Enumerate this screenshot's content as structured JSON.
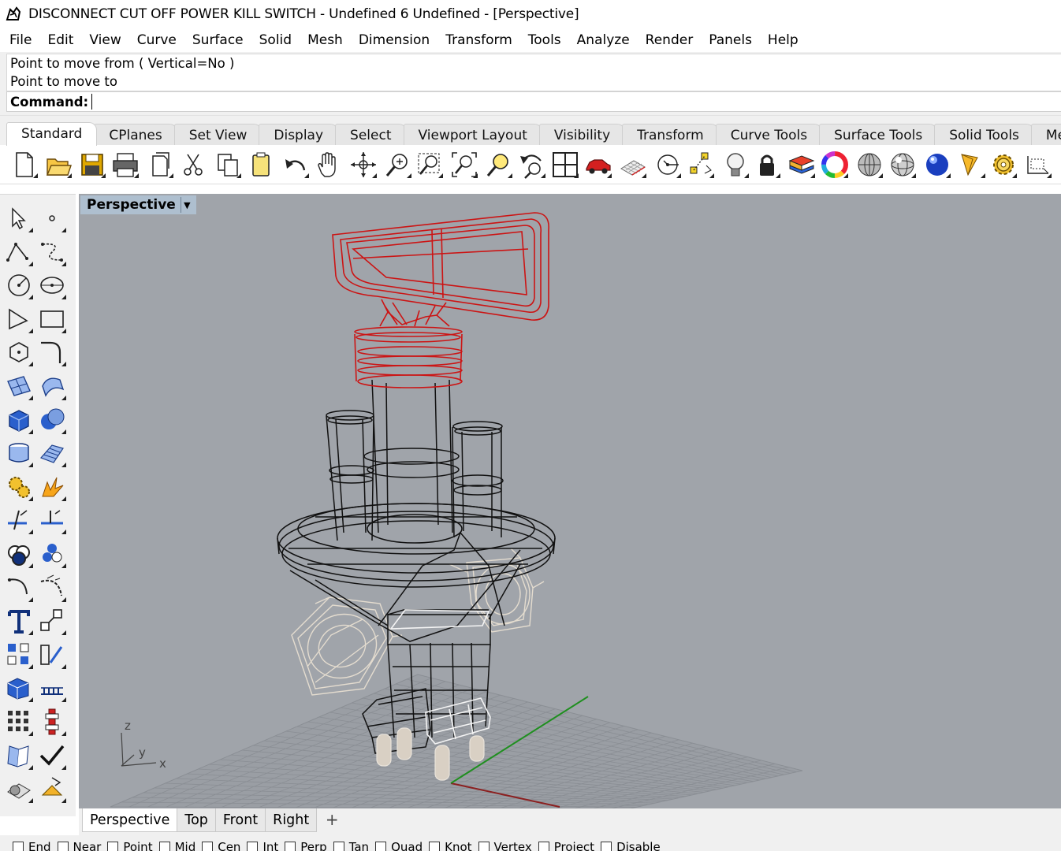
{
  "window": {
    "title": "DISCONNECT CUT OFF POWER KILL SWITCH - Undefined 6 Undefined - [Perspective]",
    "app_icon": "rhino-icon"
  },
  "menu": [
    "File",
    "Edit",
    "View",
    "Curve",
    "Surface",
    "Solid",
    "Mesh",
    "Dimension",
    "Transform",
    "Tools",
    "Analyze",
    "Render",
    "Panels",
    "Help"
  ],
  "command": {
    "history": [
      "Point to move from ( Vertical=No )",
      "Point to move to"
    ],
    "prompt_label": "Command:",
    "input_value": ""
  },
  "toolbar_tabs": {
    "items": [
      "Standard",
      "CPlanes",
      "Set View",
      "Display",
      "Select",
      "Viewport Layout",
      "Visibility",
      "Transform",
      "Curve Tools",
      "Surface Tools",
      "Solid Tools",
      "Mesh Tools"
    ],
    "active": "Standard"
  },
  "standard_tools": [
    "new-icon",
    "open-icon",
    "save-icon",
    "print-icon",
    "import-icon",
    "cut-icon",
    "copy-icon",
    "paste-icon",
    "undo-icon",
    "pan-hand-icon",
    "rotate-view-icon",
    "zoom-dynamic-icon",
    "zoom-window-icon",
    "zoom-extents-icon",
    "zoom-selected-icon",
    "undo-view-icon",
    "four-viewports-icon",
    "car-render-icon",
    "grid-icon",
    "cplane-icon",
    "object-snap-icon",
    "light-icon",
    "lock-icon",
    "layer-icon",
    "color-wheel-icon",
    "shaded-sphere-icon",
    "rendered-sphere-icon",
    "blue-sphere-icon",
    "material-icon",
    "options-gear-icon",
    "dimension-icon"
  ],
  "left_tools": [
    "select-arrow-icon",
    "point-icon",
    "polyline-icon",
    "curve-icon",
    "circle-icon",
    "ellipse-icon",
    "arc-icon",
    "rectangle-icon",
    "polygon-icon",
    "fillet-curve-icon",
    "surface-corners-icon",
    "loft-icon",
    "box-icon",
    "sphere-boolean-icon",
    "cylinder-icon",
    "mesh-plane-icon",
    "gear-transform-icon",
    "explode-icon",
    "trim-icon",
    "split-icon",
    "boolean-union-icon",
    "group-icon",
    "curve-offset-icon",
    "sweep-icon",
    "text-icon",
    "scale-icon",
    "array-icon",
    "mirror-icon",
    "block-icon",
    "dimension-ruler-icon",
    "grid-array-icon",
    "align-icon",
    "analyze-curvature-icon",
    "check-icon",
    "render-box-icon",
    "render-light-icon"
  ],
  "viewport": {
    "title": "Perspective",
    "dropdown_icon": "chevron-down-icon",
    "axis_labels": {
      "z": "z",
      "y": "y",
      "x": "x"
    },
    "colors": {
      "background": "#a0a4aa",
      "grid": "#8e9298",
      "red_part": "#cc1414",
      "black_part": "#111111",
      "white_part": "#f4f4f4",
      "cream_part": "#d8cfc3",
      "x_axis": "#8b2020",
      "y_axis": "#1f8f1f"
    }
  },
  "viewport_tabs": {
    "items": [
      "Perspective",
      "Top",
      "Front",
      "Right"
    ],
    "active": "Perspective",
    "add_label": "+"
  },
  "osnaps": [
    "End",
    "Near",
    "Point",
    "Mid",
    "Cen",
    "Int",
    "Perp",
    "Tan",
    "Quad",
    "Knot",
    "Vertex",
    "Project",
    "Disable"
  ]
}
